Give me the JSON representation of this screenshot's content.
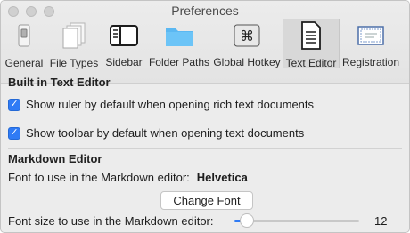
{
  "window": {
    "title": "Preferences"
  },
  "tabs": [
    {
      "label": "General",
      "icon": "general-switch-icon"
    },
    {
      "label": "File Types",
      "icon": "file-stack-icon"
    },
    {
      "label": "Sidebar",
      "icon": "sidebar-icon"
    },
    {
      "label": "Folder Paths",
      "icon": "folder-icon"
    },
    {
      "label": "Global Hotkey",
      "icon": "command-key-icon"
    },
    {
      "label": "Text Editor",
      "icon": "text-document-icon",
      "active": true
    },
    {
      "label": "Registration",
      "icon": "certificate-icon"
    }
  ],
  "built_in": {
    "title": "Built in Text Editor",
    "ruler_label": "Show ruler by default when opening rich text documents",
    "ruler_checked": true,
    "toolbar_label": "Show toolbar by default when opening text documents",
    "toolbar_checked": true
  },
  "markdown": {
    "title": "Markdown Editor",
    "font_label": "Font to use in the Markdown editor:",
    "font_value": "Helvetica",
    "change_font_button": "Change Font",
    "size_label": "Font size to use in the Markdown editor:",
    "size_value": "12",
    "size_slider_fraction": 0.1
  },
  "colors": {
    "accent": "#2f7bf5",
    "folder": "#5bb8f2"
  }
}
